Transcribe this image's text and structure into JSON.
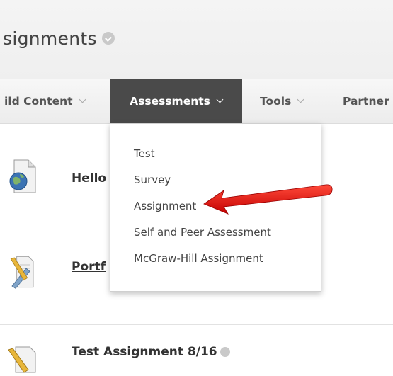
{
  "header": {
    "title": "signments"
  },
  "nav": {
    "build_content": "ild Content",
    "assessments": "Assessments",
    "tools": "Tools",
    "partner": "Partner"
  },
  "dropdown": {
    "items": [
      {
        "label": "Test"
      },
      {
        "label": "Survey"
      },
      {
        "label": "Assignment"
      },
      {
        "label": "Self and Peer Assessment"
      },
      {
        "label": "McGraw-Hill Assignment"
      }
    ]
  },
  "content": {
    "items": [
      {
        "title": "Hello",
        "icon": "web-link-icon"
      },
      {
        "title": "Portf",
        "icon": "portfolio-icon"
      },
      {
        "title": "Test Assignment 8/16",
        "icon": "assignment-icon"
      }
    ]
  },
  "colors": {
    "active_tab": "#4a4a4a",
    "arrow": "#e01010"
  }
}
